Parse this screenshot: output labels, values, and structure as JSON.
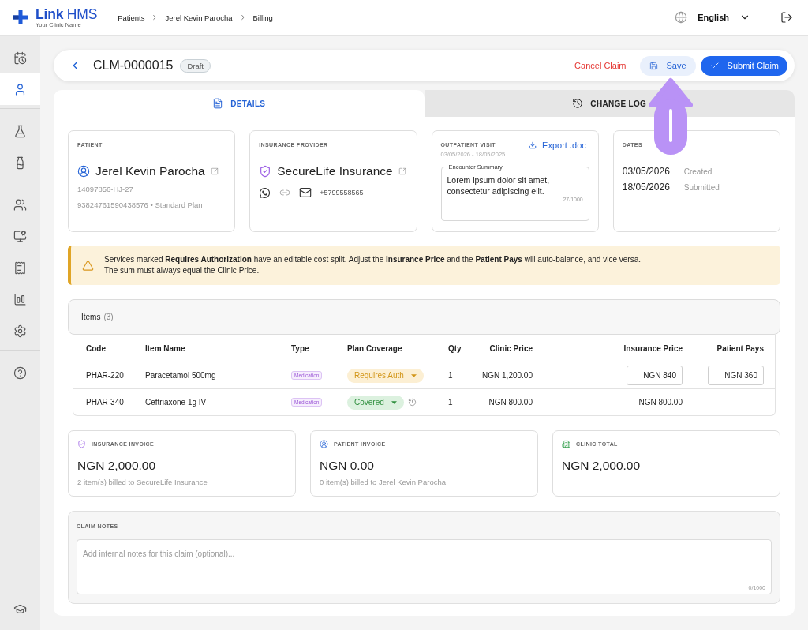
{
  "top_bar": {
    "logo": {
      "name": "**Link** HMS",
      "subtitle": "Your Clinic Name"
    },
    "breadcrumbs": [
      "Patients",
      "Jerel Kevin Parocha",
      "Billing"
    ],
    "language": "English"
  },
  "sidebar": {
    "groups": [
      {
        "items": [
          {
            "selected": false
          },
          {
            "selected": true
          }
        ]
      },
      {
        "items": [
          {
            "selected": false
          },
          {
            "selected": false
          }
        ]
      },
      {
        "items": [
          {
            "selected": false
          },
          {
            "selected": false
          },
          {
            "selected": false
          },
          {
            "selected": false
          },
          {
            "selected": false
          }
        ]
      },
      {
        "items": [
          {
            "selected": false
          }
        ]
      }
    ],
    "footer": [
      {
        "selected": false
      }
    ]
  },
  "claim": {
    "id": "CLM-0000015",
    "status": "Draft",
    "actions": [
      {
        "label": "Cancel Claim",
        "kind": "danger",
        "highlighted": false
      },
      {
        "label": "Save",
        "kind": "secondary",
        "highlighted": true
      },
      {
        "label": "Submit Claim",
        "kind": "primary",
        "highlighted": false
      }
    ]
  },
  "tabs": [
    {
      "label": "DETAILS",
      "selected": true
    },
    {
      "label": "CHANGE LOG",
      "selected": false
    }
  ],
  "patient": {
    "heading": "PATIENT",
    "name": "Jerel Kevin Parocha",
    "id": "14097856-HJ-27",
    "policy": "93824761590438576 • Standard Plan"
  },
  "insurance": {
    "heading": "INSURANCE PROVIDER",
    "name": "SecureLife Insurance",
    "phone": "+5799558565"
  },
  "visit": {
    "heading": "OUTPATIENT VISIT",
    "period": "03/05/2026 - 18/05/2025",
    "export": "Export .doc",
    "summary": {
      "label": "Encounter Summary",
      "value": "Lorem ipsum dolor sit amet, consectetur adipiscing elit.",
      "count": "27/1000"
    }
  },
  "dates": {
    "heading": "DATES",
    "entries": [
      {
        "date": "03/05/2026",
        "label": "Created"
      },
      {
        "date": "18/05/2026",
        "label": "Submitted"
      }
    ]
  },
  "alert": {
    "text": "Services marked **Requires Authorization** have an editable cost split. Adjust the **Insurance Price** and the **Patient Pays** will auto-balance, and vice versa.\nThe sum must always equal the Clinic Price."
  },
  "items": {
    "title": "Items",
    "count": "(3)",
    "columns": [
      "Code",
      "Item Name",
      "Type",
      "Plan Coverage",
      "Qty",
      "Clinic Price",
      "Insurance Price",
      "Patient Pays"
    ],
    "rows": [
      {
        "code": "PHAR-220",
        "name": "Paracetamol 500mg",
        "type": "Medication",
        "coverage": {
          "label": "Requires Auth",
          "kind": "auth"
        },
        "history": false,
        "qty": "1",
        "clinic_price": "NGN 1,200.00",
        "insurance_price": {
          "kind": "input",
          "value": "NGN 840"
        },
        "patient_pays": {
          "kind": "input",
          "value": "NGN 360"
        }
      },
      {
        "code": "PHAR-340",
        "name": "Ceftriaxone 1g IV",
        "type": "Medication",
        "coverage": {
          "label": "Covered",
          "kind": "covered"
        },
        "history": true,
        "qty": "1",
        "clinic_price": "NGN 800.00",
        "insurance_price": {
          "kind": "text",
          "value": "NGN 800.00"
        },
        "patient_pays": {
          "kind": "text",
          "value": "–"
        }
      }
    ]
  },
  "invoices": [
    {
      "kind": "insurance",
      "title": "INSURANCE INVOICE",
      "amount": "NGN 2,000.00",
      "note": "2 item(s) billed to SecureLife Insurance"
    },
    {
      "kind": "patient",
      "title": "PATIENT INVOICE",
      "amount": "NGN 0.00",
      "note": "0 item(s) billed to Jerel Kevin Parocha"
    },
    {
      "kind": "clinic",
      "title": "CLINIC TOTAL",
      "amount": "NGN 2,000.00"
    }
  ],
  "notes": {
    "title": "CLAIM NOTES",
    "placeholder": "Add internal notes for this claim (optional)...",
    "count": "0/1000"
  }
}
